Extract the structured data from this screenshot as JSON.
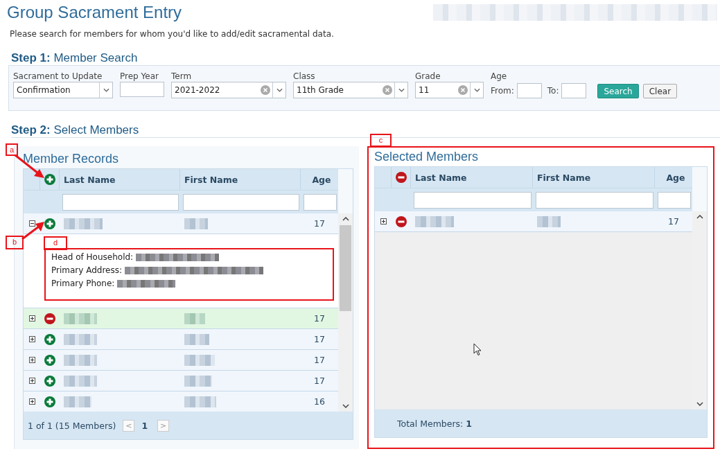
{
  "title": "Group Sacrament Entry",
  "intro": "Please search for members for whom you'd like to add/edit sacramental data.",
  "step1": {
    "heading": "**Step 1:** Member Search",
    "fields": [
      {
        "kind": "select",
        "label": "Sacrament to Update",
        "value": "Confirmation"
      },
      {
        "kind": "text",
        "label": "Prep Year"
      },
      {
        "kind": "combo",
        "label": "Term",
        "value": "2021-2022"
      },
      {
        "kind": "combo",
        "label": "Class",
        "value": "11th Grade"
      },
      {
        "kind": "combo",
        "label": "Grade",
        "value": "11"
      },
      {
        "kind": "range",
        "label": "Age",
        "from_label": "From:",
        "to_label": "To:"
      }
    ],
    "buttons": [
      {
        "kind": "primary",
        "label": "Search"
      },
      {
        "kind": "secondary",
        "label": "Clear"
      }
    ]
  },
  "step2": {
    "heading": "**Step 2:** Select Members"
  },
  "member_records": {
    "title": "Member Records",
    "header_remove": false,
    "columns": [
      "Last Name",
      "First Name",
      "Age"
    ],
    "rows": [
      {
        "expanded": true,
        "added": false,
        "highlighted": false,
        "age": "17",
        "details": [
          {
            "label": "Head of Household:"
          },
          {
            "label": "Primary Address:"
          },
          {
            "label": "Primary Phone:"
          }
        ]
      },
      {
        "expanded": false,
        "added": true,
        "highlighted": true,
        "age": "17"
      },
      {
        "expanded": false,
        "added": false,
        "highlighted": false,
        "age": "17"
      },
      {
        "expanded": false,
        "added": false,
        "highlighted": false,
        "age": "17"
      },
      {
        "expanded": false,
        "added": false,
        "highlighted": false,
        "age": "17"
      },
      {
        "expanded": false,
        "added": false,
        "highlighted": false,
        "age": "16"
      }
    ],
    "pager": {
      "summary": "1 of 1 (15 Members)",
      "prev": "<",
      "page": "1",
      "next": ">"
    }
  },
  "selected_members": {
    "title": "Selected Members",
    "header_remove": true,
    "columns": [
      "Last Name",
      "First Name",
      "Age"
    ],
    "rows": [
      {
        "expanded": false,
        "added": true,
        "highlighted": false,
        "age": "17"
      }
    ],
    "footer": "Total Members: **1**"
  },
  "annotations": [
    {
      "label": "a"
    },
    {
      "label": "b"
    },
    {
      "label": "c"
    },
    {
      "label": "d"
    }
  ]
}
